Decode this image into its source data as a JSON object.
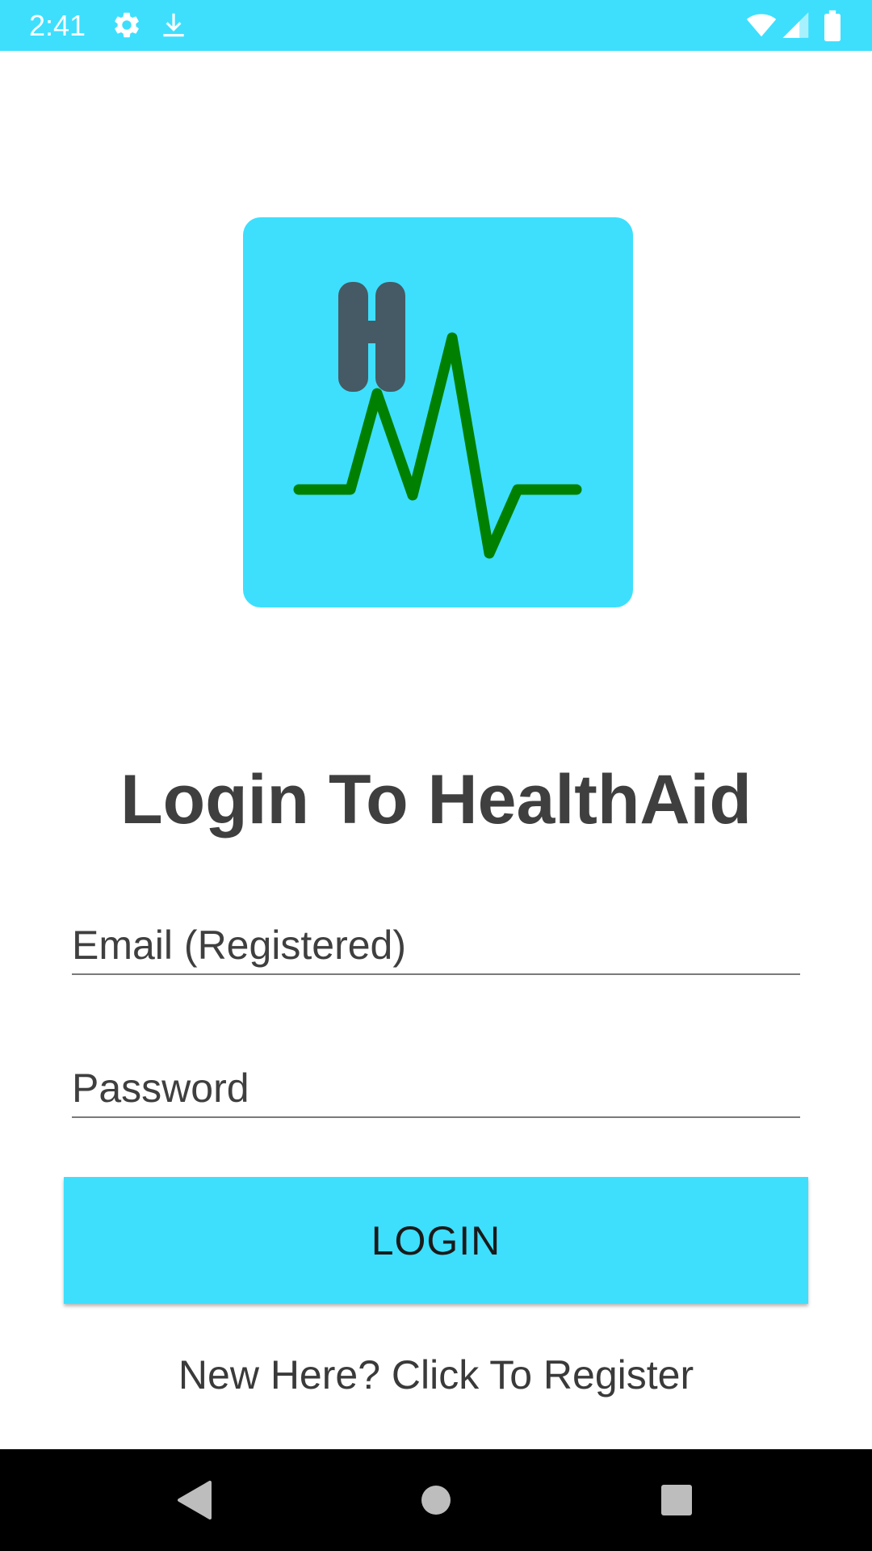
{
  "status_bar": {
    "time": "2:41",
    "icons": [
      "settings-icon",
      "download-icon",
      "wifi-icon",
      "signal-icon",
      "battery-icon"
    ],
    "background": "#3ddffd"
  },
  "logo": {
    "letter": "H",
    "background": "#3ddffd",
    "letter_color": "#455a64",
    "pulse_color": "#008000"
  },
  "title": "Login To HealthAid",
  "email": {
    "placeholder": "Email (Registered)",
    "value": ""
  },
  "password": {
    "placeholder": "Password",
    "value": ""
  },
  "login_button": {
    "label": "LOGIN",
    "color": "#3ddffd"
  },
  "register_link": "New Here? Click To Register",
  "nav_bar": {
    "buttons": [
      "back-icon",
      "home-icon",
      "recents-icon"
    ]
  }
}
